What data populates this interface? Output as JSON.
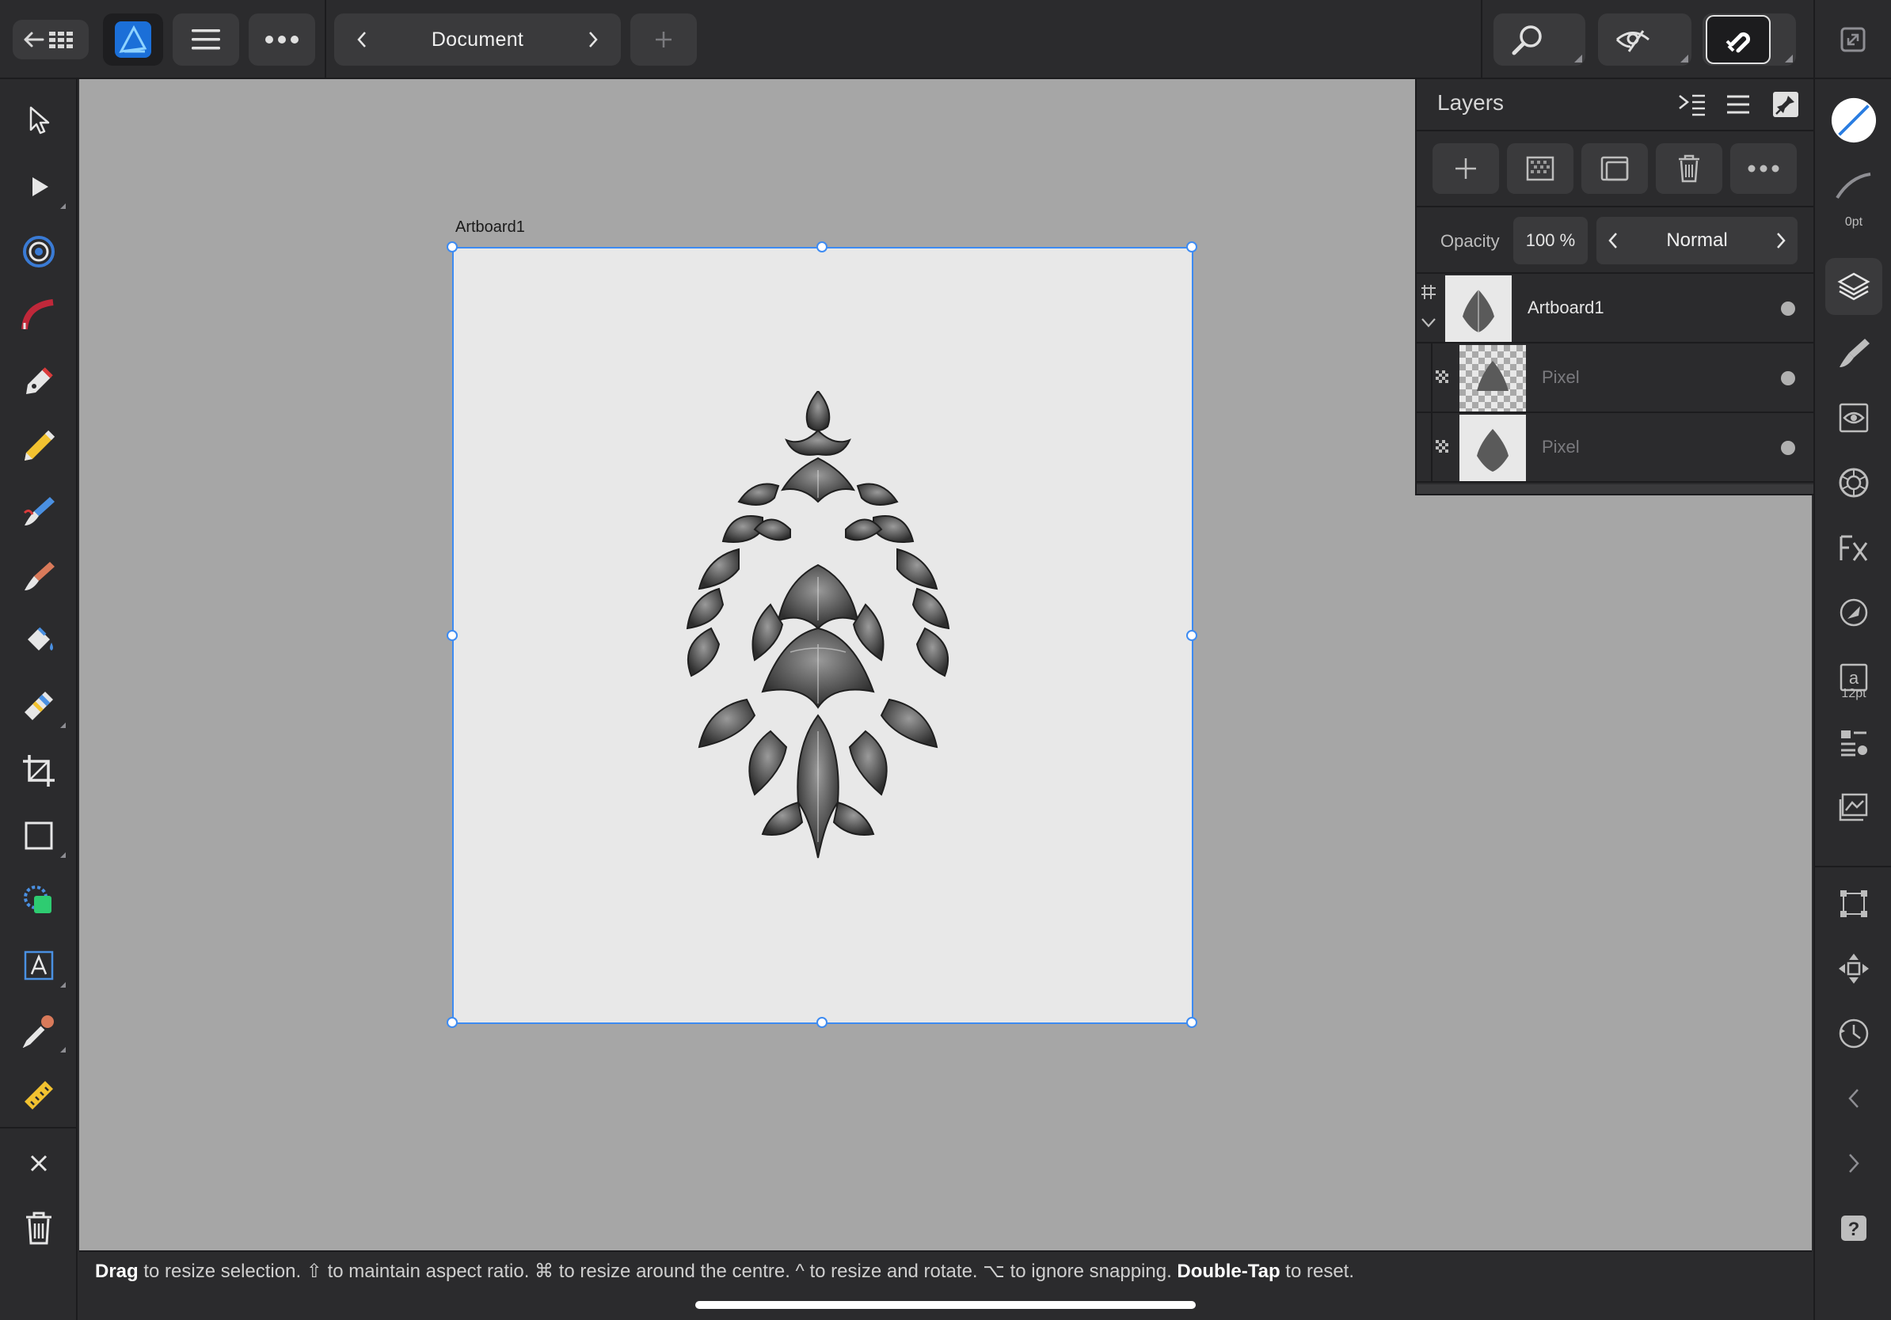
{
  "topbar": {
    "document_title": "Document",
    "icons": [
      "back-grid-icon",
      "affinity-designer-logo",
      "hamburger-menu-icon",
      "more-icon",
      "chevron-left-icon",
      "chevron-right-icon",
      "add-document-icon",
      "zoom-icon",
      "view-mode-icon",
      "snapping-magnet-icon",
      "fullscreen-icon"
    ]
  },
  "left_tools": [
    "move-tool-icon",
    "node-tool-icon",
    "corner-tool-icon",
    "pencil-curve-tool-icon",
    "pen-tool-icon",
    "pencil-tool-icon",
    "vector-brush-tool-icon",
    "brush-icon",
    "fill-tool-icon",
    "transparency-tool-icon",
    "crop-tool-icon",
    "rectangle-tool-icon",
    "shape-builder-icon",
    "artistic-text-tool-icon",
    "color-picker-icon",
    "measure-tool-icon",
    "close-icon",
    "trash-icon"
  ],
  "canvas": {
    "artboard_label": "Artboard1",
    "background": "#a6a6a6",
    "artboard_color": "#e8e8e8",
    "selection_color": "#3d8bf2"
  },
  "status": {
    "segments": [
      {
        "text": "Drag",
        "bold": true
      },
      {
        "text": " to resize selection. ⇧ to maintain aspect ratio. ⌘ to resize around the centre. ^ to resize and rotate. ⌥ to ignore snapping. ",
        "bold": false
      },
      {
        "text": "Double-Tap",
        "bold": true
      },
      {
        "text": " to reset.",
        "bold": false
      }
    ]
  },
  "layers_panel": {
    "title": "Layers",
    "opacity_label": "Opacity",
    "opacity_value": "100 %",
    "blend_mode": "Normal",
    "layers": [
      {
        "name": "Artboard1",
        "type": "artboard",
        "expanded": true
      },
      {
        "name": "Pixel",
        "type": "pixel"
      },
      {
        "name": "Pixel",
        "type": "pixel"
      }
    ]
  },
  "right_studio": {
    "stroke_width": "0pt",
    "text_size": "12pt",
    "icons": [
      "fill-stroke-swatch",
      "stroke-icon",
      "layers-icon",
      "brushes-icon",
      "appearance-icon",
      "color-wheel-icon",
      "fx-effects-icon",
      "styles-icon",
      "text-style-icon",
      "text-frame-icon",
      "assets-icon",
      "transform-icon",
      "navigator-icon",
      "history-icon",
      "collapse-left-icon",
      "expand-right-icon",
      "help-icon"
    ]
  },
  "colors": {
    "ui_background": "#2b2b2d",
    "button_background": "#3a3a3c",
    "accent": "#3d8bf2"
  }
}
